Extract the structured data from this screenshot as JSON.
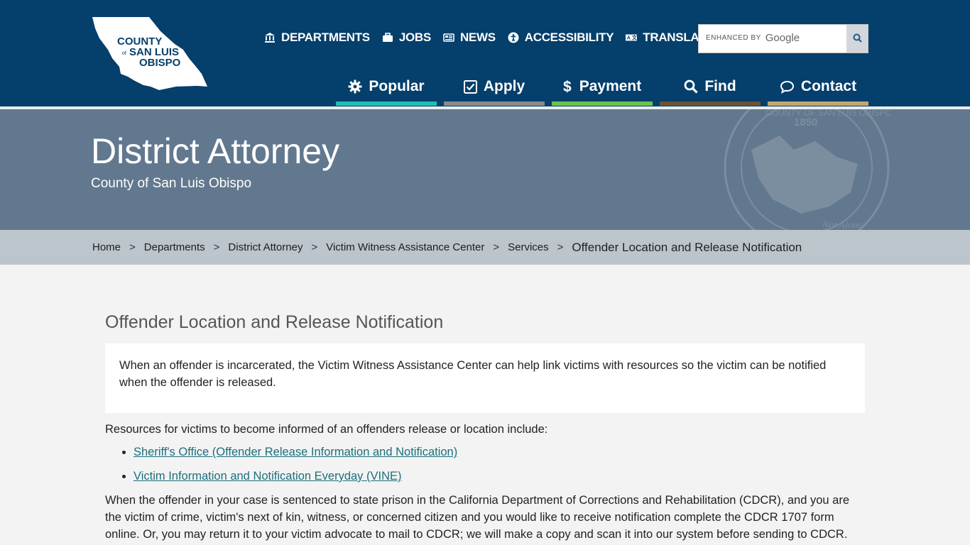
{
  "header": {
    "logo": {
      "line1": "COUNTY",
      "of": "of",
      "line2": "SAN LUIS",
      "line3": "OBISPO"
    },
    "utility_nav": [
      {
        "label": "DEPARTMENTS",
        "icon": "building-icon"
      },
      {
        "label": "JOBS",
        "icon": "briefcase-icon"
      },
      {
        "label": "NEWS",
        "icon": "newspaper-icon"
      },
      {
        "label": "ACCESSIBILITY",
        "icon": "accessibility-icon"
      },
      {
        "label": "TRANSLATE",
        "icon": "translate-icon"
      }
    ],
    "search": {
      "brand_text": "ENHANCED BY",
      "brand_name": "Google",
      "placeholder": ""
    },
    "main_nav": [
      {
        "label": "Popular",
        "icon": "gear-icon",
        "color": "#1fbfb8"
      },
      {
        "label": "Apply",
        "icon": "checkbox-icon",
        "color": "#8a8a8a"
      },
      {
        "label": "Payment",
        "icon": "dollar-icon",
        "color": "#6cc24a"
      },
      {
        "label": "Find",
        "icon": "search-icon",
        "color": "#6d5235"
      },
      {
        "label": "Contact",
        "icon": "chat-bubble-icon",
        "color": "#c4a56e"
      }
    ]
  },
  "banner": {
    "title": "District Attorney",
    "subtitle": "County of San Luis Obispo",
    "seal_year": "1850",
    "seal_text": "COUNTY OF SAN LUIS OBISPO",
    "seal_motto": "Not Alone"
  },
  "breadcrumb": [
    {
      "label": "Home"
    },
    {
      "label": "Departments"
    },
    {
      "label": "District Attorney"
    },
    {
      "label": "Victim Witness Assistance Center"
    },
    {
      "label": "Services"
    },
    {
      "label": "Offender Location and Release Notification"
    }
  ],
  "breadcrumb_sep": ">",
  "content": {
    "title": "Offender Location and Release Notification",
    "intro": "When an offender is incarcerated, the Victim Witness Assistance Center can help link victims with resources so the victim can be notified when the offender is released.",
    "resources_intro": "Resources for victims to become informed of an offenders release or location include:",
    "resources": [
      {
        "label": "Sheriff's Office (Offender Release Information and Notification)"
      },
      {
        "label": "Victim Information and Notification Everyday (VINE)"
      }
    ],
    "cdcr_para": "When the offender in your case is sentenced to state prison in the California Department of Corrections and Rehabilitation (CDCR), and you are the victim of crime, victim's next of kin, witness, or concerned citizen and you would like to receive notification complete the CDCR 1707 form online. Or, you may return it to your victim advocate to mail to CDCR; we will make a copy and scan it into our system before sending to CDCR."
  }
}
